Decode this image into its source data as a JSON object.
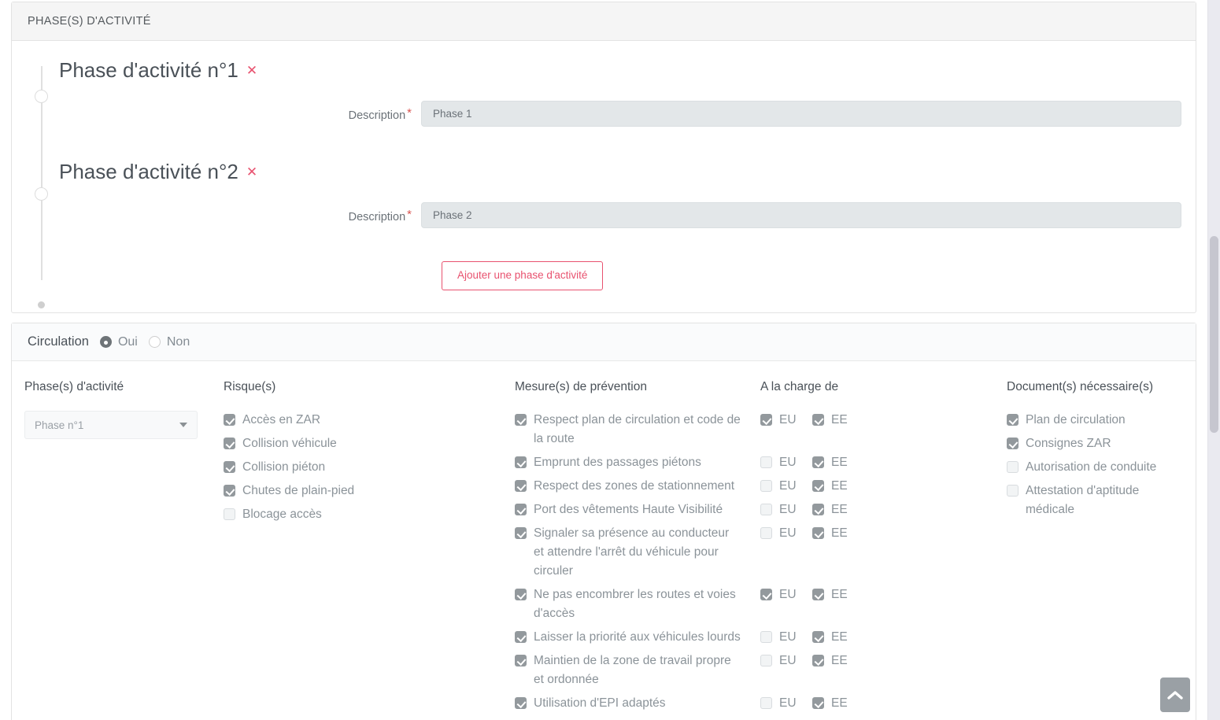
{
  "phases_panel": {
    "header": "PHASE(S) D'ACTIVITÉ",
    "phases": [
      {
        "title": "Phase d'activité n°1",
        "delete_glyph": "✕",
        "desc_label": "Description",
        "required_mark": "*",
        "desc_value": "Phase 1"
      },
      {
        "title": "Phase d'activité n°2",
        "delete_glyph": "✕",
        "desc_label": "Description",
        "required_mark": "*",
        "desc_value": "Phase 2"
      }
    ],
    "add_button": "Ajouter une phase d'activité"
  },
  "circulation": {
    "label": "Circulation",
    "options": [
      {
        "label": "Oui",
        "selected": true
      },
      {
        "label": "Non",
        "selected": false
      }
    ]
  },
  "matrix": {
    "headers": {
      "phase": "Phase(s) d'activité",
      "risk": "Risque(s)",
      "mesure": "Mesure(s) de prévention",
      "charge": "A la charge de",
      "document": "Document(s) nécessaire(s)"
    },
    "phase_select": {
      "value": "Phase n°1",
      "caret": "chevron-down"
    },
    "risks": [
      {
        "label": "Accès en ZAR",
        "checked": true
      },
      {
        "label": "Collision véhicule",
        "checked": true
      },
      {
        "label": "Collision piéton",
        "checked": true
      },
      {
        "label": "Chutes de plain-pied",
        "checked": true
      },
      {
        "label": "Blocage accès",
        "checked": false
      }
    ],
    "charge_labels": {
      "eu": "EU",
      "ee": "EE"
    },
    "mesures": [
      {
        "label": "Respect plan de circulation et code de la route",
        "checked": true,
        "eu": true,
        "ee": true
      },
      {
        "label": "Emprunt des passages piétons",
        "checked": true,
        "eu": false,
        "ee": true
      },
      {
        "label": "Respect des zones de stationnement",
        "checked": true,
        "eu": false,
        "ee": true
      },
      {
        "label": "Port des vêtements Haute Visibilité",
        "checked": true,
        "eu": false,
        "ee": true
      },
      {
        "label": "Signaler sa présence au conducteur et attendre l'arrêt du véhicule pour circuler",
        "checked": true,
        "eu": false,
        "ee": true
      },
      {
        "label": "Ne pas encombrer les routes et voies d'accès",
        "checked": true,
        "eu": true,
        "ee": true
      },
      {
        "label": "Laisser la priorité aux véhicules lourds",
        "checked": true,
        "eu": false,
        "ee": true
      },
      {
        "label": "Maintien de la zone de travail propre et ordonnée",
        "checked": true,
        "eu": false,
        "ee": true
      },
      {
        "label": "Utilisation d'EPI adaptés",
        "checked": true,
        "eu": false,
        "ee": true
      }
    ],
    "documents": [
      {
        "label": "Plan de circulation",
        "checked": true
      },
      {
        "label": "Consignes ZAR",
        "checked": true
      },
      {
        "label": "Autorisation de conduite",
        "checked": false
      },
      {
        "label": "Attestation d'aptitude médicale",
        "checked": false
      }
    ]
  },
  "scroll_to_top": {
    "icon": "chevron-up-icon"
  },
  "colors": {
    "accent_pink": "#e8526f",
    "checkbox_checked": "#93999d",
    "text_muted": "#8b9399",
    "header_bg": "#f5f5f5"
  }
}
